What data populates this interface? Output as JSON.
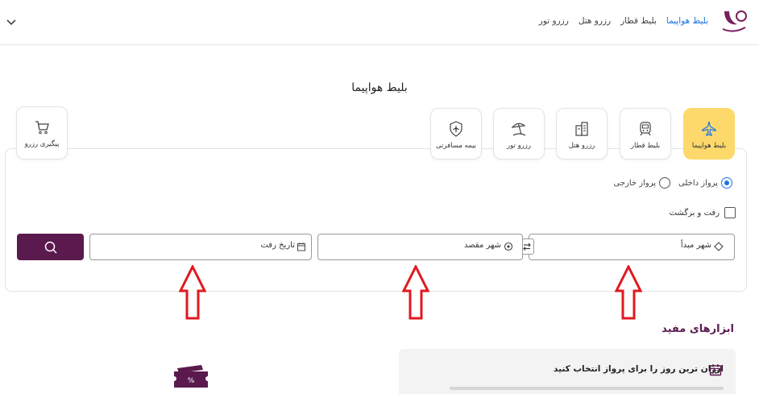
{
  "nav": {
    "links": [
      {
        "label": "بلیط هواپیما",
        "active": true
      },
      {
        "label": "بلیط قطار",
        "active": false
      },
      {
        "label": "رزرو هتل",
        "active": false
      },
      {
        "label": "رزرو تور",
        "active": false
      }
    ],
    "logo_icon": "brand-logo-icon",
    "menu_icon": "chevron-down-icon"
  },
  "page_title": "بلیط هواپیما",
  "tabs": [
    {
      "label": "بلیط هواپیما",
      "icon": "airplane-icon",
      "active": true
    },
    {
      "label": "بلیط قطار",
      "icon": "train-icon",
      "active": false
    },
    {
      "label": "رزرو هتل",
      "icon": "hotel-icon",
      "active": false
    },
    {
      "label": "رزرو تور",
      "icon": "beach-umbrella-icon",
      "active": false
    },
    {
      "label": "بیمه مسافرتی",
      "icon": "shield-plane-icon",
      "active": false
    },
    {
      "label": "پیگیری رزرو",
      "icon": "cart-icon",
      "active": false
    }
  ],
  "search": {
    "trip_types": [
      {
        "label": "پرواز داخلی",
        "checked": true
      },
      {
        "label": "پرواز خارجی",
        "checked": false
      }
    ],
    "round_trip_label": "رفت و برگشت",
    "round_trip_checked": false,
    "origin_label": "شهر مبدأ",
    "destination_label": "شهر مقصد",
    "date_label": "تاریخ رفت",
    "swap_icon": "swap-icon",
    "search_icon": "search-icon"
  },
  "tools": {
    "title": "ابزارهای مفید",
    "card_title": "ارزان ترین روز را برای پرواز انتخاب کنید",
    "card_icon": "calendar-icon",
    "discount_icon": "discount-ticket-icon"
  },
  "colors": {
    "brand": "#5a1a4e",
    "active_tab": "#fcd96a",
    "link_active": "#1a73e8",
    "annotation_arrow": "#e0191f"
  }
}
